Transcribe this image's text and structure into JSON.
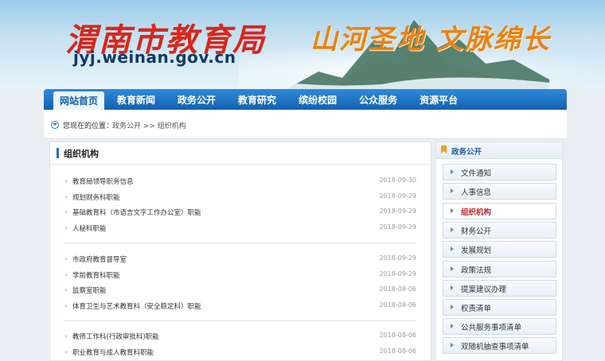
{
  "header": {
    "site_name": "渭南市教育局",
    "site_url": "jyj.weinan.gov.cn",
    "slogan": "山河圣地 文脉绵长"
  },
  "nav": {
    "items": [
      "网站首页",
      "教育新闻",
      "政务公开",
      "教育研究",
      "缤纷校园",
      "公众服务",
      "资源平台"
    ],
    "active": "网站首页"
  },
  "breadcrumb": {
    "label": "您现在的位置：",
    "path": "政务公开 >> 组织机构"
  },
  "content": {
    "title": "组织机构",
    "groups": [
      [
        {
          "title": "教育局领导职务信息",
          "date": "2018-09-30"
        },
        {
          "title": "规划财务科职能",
          "date": "2018-09-29"
        },
        {
          "title": "基础教育科（市语言文字工作办公室）职能",
          "date": "2018-09-29"
        },
        {
          "title": "人秘科职能",
          "date": "2018-09-29"
        }
      ],
      [
        {
          "title": "市政府教育督导室",
          "date": "2018-09-29"
        },
        {
          "title": "学前教育科职能",
          "date": "2018-09-29"
        },
        {
          "title": "监察室职能",
          "date": "2018-08-06"
        },
        {
          "title": "体育卫生与艺术教育科（安全稳定科）职能",
          "date": "2018-08-06"
        }
      ],
      [
        {
          "title": "教师工作科(行政审批科)职能",
          "date": "2018-08-06"
        },
        {
          "title": "职业教育与成人教育科职能",
          "date": "2018-08-06"
        }
      ]
    ]
  },
  "sidebar": {
    "title": "政务公开",
    "items": [
      "文件通知",
      "人事信息",
      "组织机构",
      "财务公开",
      "发展规划",
      "政策法规",
      "提案建议办理",
      "权责清单",
      "公共服务事项清单",
      "双随机抽查事项清单"
    ],
    "active": "组织机构"
  }
}
